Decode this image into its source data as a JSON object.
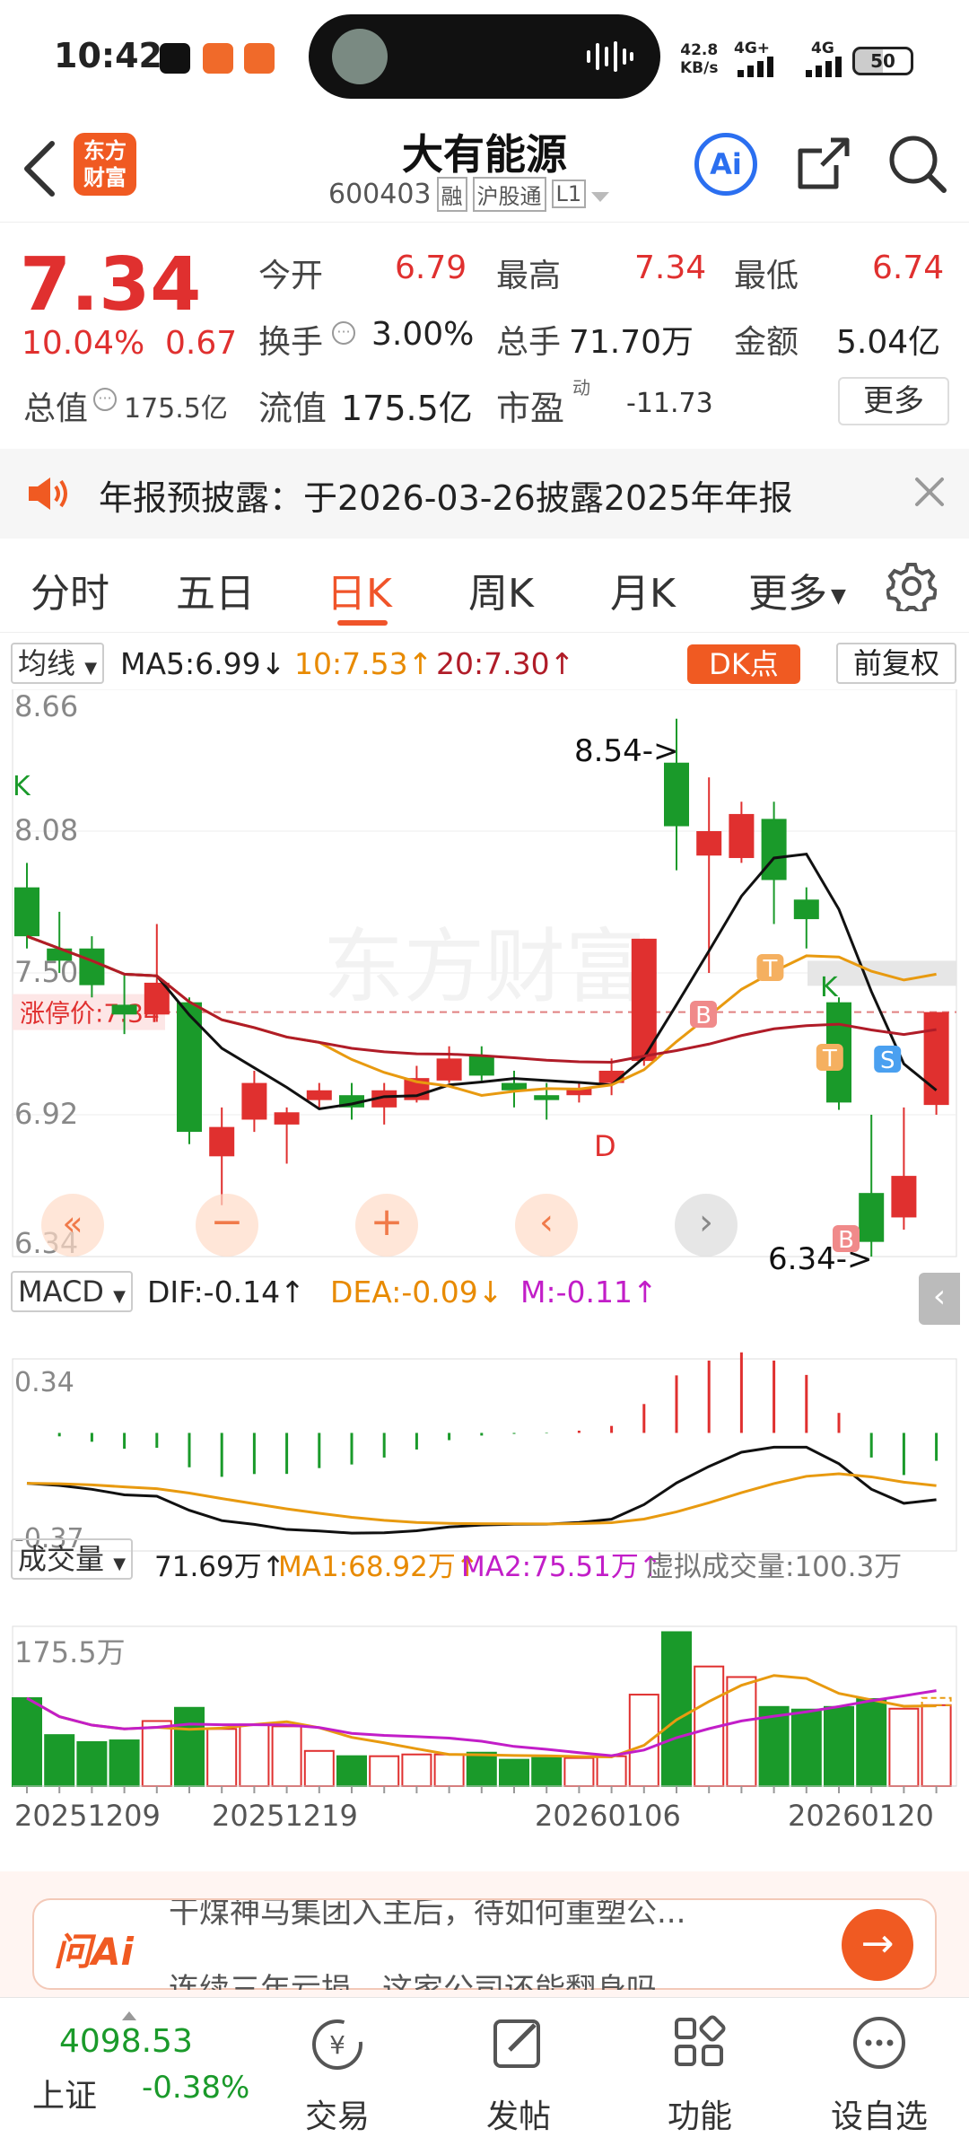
{
  "status": {
    "time": "10:42",
    "net_speed": "42.8",
    "net_unit": "KB/s",
    "sig1": "4G+",
    "sig2": "4G",
    "battery": "50"
  },
  "header": {
    "title": "大有能源",
    "code": "600403",
    "tag1": "融",
    "tag2": "沪股通",
    "tag3": "L1",
    "logo_line1": "东方",
    "logo_line2": "财富",
    "ai_label": "Ai"
  },
  "quote": {
    "price": "7.34",
    "change_pct": "10.04%",
    "change": "0.67",
    "open_label": "今开",
    "open": "6.79",
    "high_label": "最高",
    "high": "7.34",
    "low_label": "最低",
    "low": "6.74",
    "turnover_label": "换手",
    "turnover": "3.00%",
    "volume_label": "总手",
    "volume": "71.70万",
    "amount_label": "金额",
    "amount": "5.04亿",
    "mktcap_label": "总值",
    "mktcap": "175.5亿",
    "float_label": "流值",
    "float_cap": "175.5亿",
    "pe_label": "市盈",
    "pe_sup": "动",
    "pe": "-11.73",
    "more_button": "更多"
  },
  "notice": {
    "text": "年报预披露：于2026-03-26披露2025年年报"
  },
  "tabs": [
    "分时",
    "五日",
    "日K",
    "周K",
    "月K",
    "更多"
  ],
  "active_tab": "日K",
  "ma_bar": {
    "selector": "均线",
    "ma5": "MA5:6.99",
    "ma10": "10:7.53",
    "ma20": "20:7.30",
    "dk_button": "DK点",
    "adjust_button": "前复权"
  },
  "kline": {
    "y_labels": [
      "8.66",
      "8.08",
      "7.50",
      "6.92",
      "6.34"
    ],
    "limit_label": "涨停价:7.34",
    "annotations": {
      "high": "8.54->",
      "low": "6.34->",
      "d": "D",
      "b1": "B",
      "b2": "B",
      "t1": "T",
      "t2": "T",
      "k1": "K",
      "k2": "K",
      "s": "S"
    }
  },
  "macd_bar": {
    "selector": "MACD",
    "dif": "DIF:-0.14",
    "dea": "DEA:-0.09",
    "m": "M:-0.11",
    "top": "0.34",
    "bottom": "-0.37"
  },
  "vol_bar": {
    "selector": "成交量",
    "vol": "71.69万",
    "ma1": "MA1:68.92万",
    "ma2": "MA2:75.51万",
    "virtual": "虚拟成交量:100.3万",
    "top": "175.5万"
  },
  "x_dates": [
    "20251209",
    "20251219",
    "20260106",
    "20260120"
  ],
  "chart_data": {
    "type": "candlestick",
    "price_range": [
      6.34,
      8.66
    ],
    "candles": [
      {
        "o": 7.85,
        "c": 7.65,
        "h": 7.95,
        "l": 7.6
      },
      {
        "o": 7.6,
        "c": 7.55,
        "h": 7.75,
        "l": 7.5
      },
      {
        "o": 7.6,
        "c": 7.45,
        "h": 7.65,
        "l": 7.4
      },
      {
        "o": 7.37,
        "c": 7.33,
        "h": 7.5,
        "l": 7.25
      },
      {
        "o": 7.33,
        "c": 7.46,
        "h": 7.7,
        "l": 7.3
      },
      {
        "o": 7.38,
        "c": 6.85,
        "h": 7.4,
        "l": 6.8
      },
      {
        "o": 6.75,
        "c": 6.87,
        "h": 6.95,
        "l": 6.55
      },
      {
        "o": 6.9,
        "c": 7.05,
        "h": 7.1,
        "l": 6.85
      },
      {
        "o": 6.88,
        "c": 6.93,
        "h": 6.95,
        "l": 6.72
      },
      {
        "o": 6.98,
        "c": 7.02,
        "h": 7.05,
        "l": 6.95
      },
      {
        "o": 7.0,
        "c": 6.95,
        "h": 7.05,
        "l": 6.9
      },
      {
        "o": 6.95,
        "c": 7.02,
        "h": 7.05,
        "l": 6.88
      },
      {
        "o": 6.98,
        "c": 7.07,
        "h": 7.12,
        "l": 6.97
      },
      {
        "o": 7.06,
        "c": 7.15,
        "h": 7.2,
        "l": 7.05
      },
      {
        "o": 7.16,
        "c": 7.08,
        "h": 7.2,
        "l": 7.06
      },
      {
        "o": 7.05,
        "c": 7.02,
        "h": 7.1,
        "l": 6.95
      },
      {
        "o": 7.0,
        "c": 6.98,
        "h": 7.05,
        "l": 6.9
      },
      {
        "o": 7.0,
        "c": 7.03,
        "h": 7.05,
        "l": 6.97
      },
      {
        "o": 7.05,
        "c": 7.1,
        "h": 7.15,
        "l": 7.0
      },
      {
        "o": 7.14,
        "c": 7.64,
        "h": 7.64,
        "l": 7.12
      },
      {
        "o": 8.36,
        "c": 8.1,
        "h": 8.54,
        "l": 7.92
      },
      {
        "o": 7.98,
        "c": 8.08,
        "h": 8.3,
        "l": 7.5
      },
      {
        "o": 7.97,
        "c": 8.15,
        "h": 8.2,
        "l": 7.95
      },
      {
        "o": 8.13,
        "c": 7.88,
        "h": 8.2,
        "l": 7.7
      },
      {
        "o": 7.8,
        "c": 7.72,
        "h": 7.85,
        "l": 7.6
      },
      {
        "o": 7.38,
        "c": 6.97,
        "h": 7.4,
        "l": 6.94
      },
      {
        "o": 6.6,
        "c": 6.4,
        "h": 6.92,
        "l": 6.34
      },
      {
        "o": 6.5,
        "c": 6.67,
        "h": 6.95,
        "l": 6.45
      },
      {
        "o": 6.96,
        "c": 7.34,
        "h": 7.34,
        "l": 6.92
      }
    ],
    "volumes": [
      100,
      58,
      50,
      52,
      74,
      89,
      65,
      70,
      68,
      40,
      34,
      34,
      36,
      36,
      38,
      30,
      32,
      32,
      34,
      104,
      175,
      136,
      124,
      90,
      87,
      90,
      99,
      88,
      92
    ]
  },
  "askbar": {
    "logo": "问Ai",
    "line1": "干煤神马集团入主后，待如何重塑公...",
    "line2": "连续三年亏损，这家公司还能翻身吗"
  },
  "bottom": {
    "index_value": "4098.53",
    "index_name": "上证",
    "index_change": "-0.38%",
    "nav": [
      "交易",
      "发帖",
      "功能",
      "设自选"
    ]
  }
}
